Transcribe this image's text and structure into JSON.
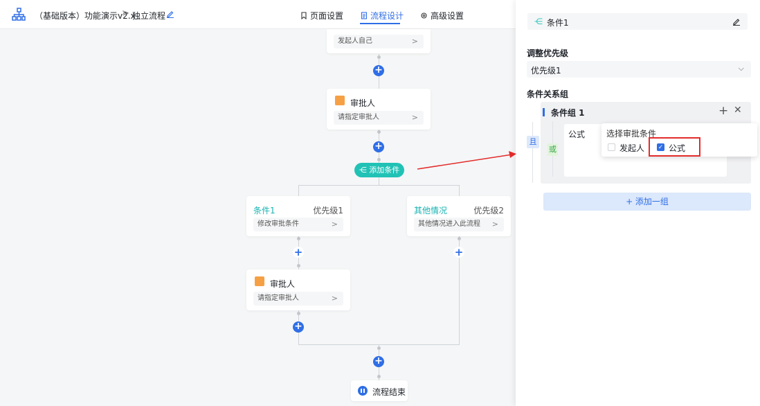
{
  "header": {
    "app_title": "（基础版本）功能演示v2.x",
    "separator": ">",
    "flow_name": "独立流程",
    "tabs": [
      {
        "label": "页面设置",
        "icon": "bookmark-icon"
      },
      {
        "label": "流程设计",
        "icon": "document-icon"
      },
      {
        "label": "高级设置",
        "icon": "gear-icon"
      }
    ],
    "active_tab": "流程设计"
  },
  "canvas": {
    "initiator_node": {
      "sub_label": "发起人自己"
    },
    "approver_node": {
      "title": "审批人",
      "sub_label": "请指定审批人"
    },
    "add_condition_label": "添加条件",
    "branches": [
      {
        "name": "条件1",
        "priority": "优先级1",
        "sub_label": "修改审批条件"
      },
      {
        "name": "其他情况",
        "priority": "优先级2",
        "sub_label": "其他情况进入此流程"
      }
    ],
    "branch_approver": {
      "title": "审批人",
      "sub_label": "请指定审批人"
    },
    "end_node": {
      "label": "流程结束"
    },
    "chevron": ">",
    "plus": "+"
  },
  "panel": {
    "title": "条件1",
    "priority_section_label": "调整优先级",
    "priority_value": "优先级1",
    "group_section_label": "条件关系组",
    "and_label": "且",
    "or_label": "或",
    "group_title": "条件组 1",
    "condition_label": "公式",
    "popover": {
      "title": "选择审批条件",
      "options": [
        {
          "label": "发起人",
          "checked": false
        },
        {
          "label": "公式",
          "checked": true
        }
      ]
    },
    "add_group_label": "+ 添加一组"
  },
  "colors": {
    "accent": "#2f6ee6",
    "teal": "#21c2b6",
    "highlight_red": "#e32b2b"
  }
}
